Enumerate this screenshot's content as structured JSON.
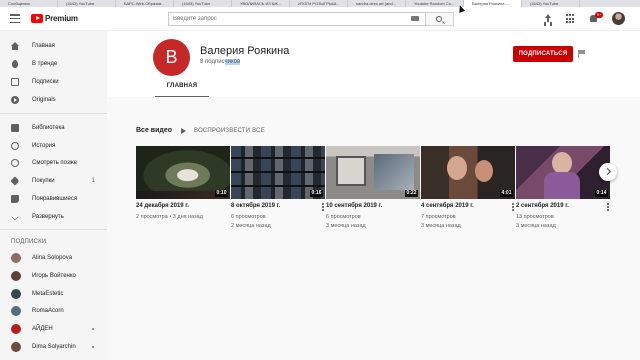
{
  "browser_tabs": [
    {
      "label": "Сообщения"
    },
    {
      "label": "(1643) YouTube"
    },
    {
      "label": "БАРС.Web-Образов..."
    },
    {
      "label": "(1643) YouTube"
    },
    {
      "label": "УВОЛИЛАСЬ ИЗ ШК..."
    },
    {
      "label": "ИТОГИ РОЗЫГРЫШ..."
    },
    {
      "label": "sandra cires art (and..."
    },
    {
      "label": "Youtube Random Co..."
    },
    {
      "label": "Валерия Роякина -..."
    },
    {
      "label": "(1643) YouTube"
    }
  ],
  "masthead": {
    "logo_text": "Premium",
    "search_placeholder": "Введите запрос",
    "notification_count": "9+"
  },
  "sidebar": {
    "main_items": [
      {
        "label": "Главная",
        "icon": "home-icon"
      },
      {
        "label": "В тренде",
        "icon": "fire-icon"
      },
      {
        "label": "Подписки",
        "icon": "subscriptions-icon"
      },
      {
        "label": "Originals",
        "icon": "originals-icon"
      }
    ],
    "library_items": [
      {
        "label": "Библиотека",
        "icon": "library-icon",
        "count": ""
      },
      {
        "label": "История",
        "icon": "history-icon",
        "count": ""
      },
      {
        "label": "Смотреть позже",
        "icon": "watch-later-icon",
        "count": ""
      },
      {
        "label": "Покупки",
        "icon": "tag-icon",
        "count": "1"
      },
      {
        "label": "Понравившиеся",
        "icon": "thumbs-up-icon",
        "count": ""
      },
      {
        "label": "Развернуть",
        "icon": "chevron-down-icon",
        "count": ""
      }
    ],
    "subscriptions_heading": "ПОДПИСКИ",
    "subscriptions": [
      {
        "name": "Alina Solopova",
        "color": "#8d6e63",
        "live": false
      },
      {
        "name": "Игорь Войтенко",
        "color": "#5d4037",
        "live": false
      },
      {
        "name": "MetaEstetic",
        "color": "#37474f",
        "live": false
      },
      {
        "name": "RomaAcorn",
        "color": "#546e7a",
        "live": false
      },
      {
        "name": "АЙДЕН",
        "color": "#b71c1c",
        "live": true
      },
      {
        "name": "Dima Solyarchin",
        "color": "#6d4c41",
        "live": true
      }
    ]
  },
  "channel": {
    "avatar_letter": "В",
    "avatar_color": "#c62828",
    "name": "Валерия Роякина",
    "subscribers_prefix": "8 подпис",
    "subscribers_selected": "чиков",
    "subscribe_label": "ПОДПИСАТЬСЯ",
    "tab_label": "ГЛАВНАЯ"
  },
  "videos_section": {
    "title": "Все видео",
    "play_all_label": "ВОСПРОИЗВЕСТИ ВСЕ"
  },
  "videos": [
    {
      "duration": "0:10",
      "date": "24 декабря 2019 г.",
      "views": "2 просмотра • 3 дня назад",
      "ago": ""
    },
    {
      "duration": "0:16",
      "date": "8 октября 2019 г.",
      "views": "6 просмотров",
      "ago": "2 месяца назад"
    },
    {
      "duration": "0:22",
      "date": "10 сентября 2019 г.",
      "views": "6 просмотров",
      "ago": "3 месяца назад"
    },
    {
      "duration": "4:01",
      "date": "4 сентября 2019 г.",
      "views": "7 просмотров",
      "ago": "3 месяца назад"
    },
    {
      "duration": "0:14",
      "date": "2 сентября 2019 г.",
      "views": "13 просмотров",
      "ago": "3 месяца назад"
    }
  ],
  "colors": {
    "brand_red": "#ff0000",
    "subscribe_red": "#cc0000",
    "text_primary": "#212121",
    "text_secondary": "#606060"
  }
}
